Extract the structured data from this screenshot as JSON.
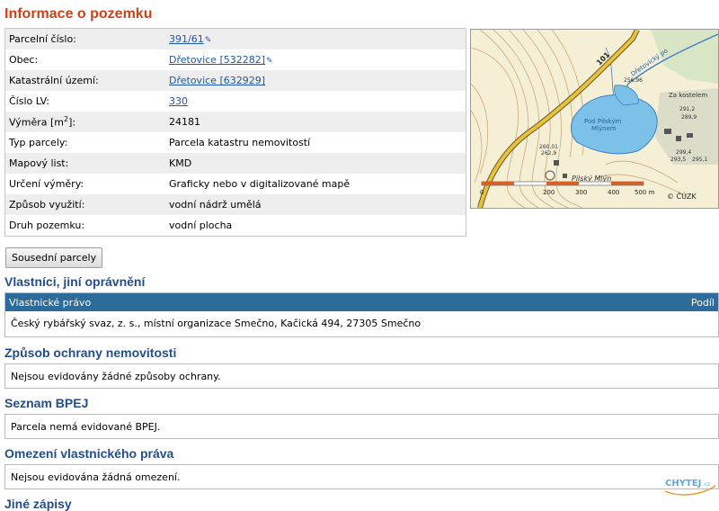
{
  "page_title": "Informace o pozemku",
  "parcel": {
    "rows": [
      {
        "key": "Parcelní číslo:",
        "value": "391/61",
        "link": true,
        "edit": true
      },
      {
        "key": "Obec:",
        "value": "Dřetovice [532282]",
        "link": true,
        "edit": true
      },
      {
        "key": "Katastrální území:",
        "value": "Dřetovice [632929]",
        "link": true,
        "edit": false
      },
      {
        "key": "Číslo LV:",
        "value": "330",
        "link": true,
        "edit": false
      },
      {
        "key_prefix": "Výměra [m",
        "key_sup": "2",
        "key_suffix": "]:",
        "value": "24181",
        "link": false
      },
      {
        "key": "Typ parcely:",
        "value": "Parcela katastru nemovitostí",
        "link": false
      },
      {
        "key": "Mapový list:",
        "value": "KMD",
        "link": false
      },
      {
        "key": "Určení výměry:",
        "value": "Graficky nebo v digitalizované mapě",
        "link": false
      },
      {
        "key": "Způsob využití:",
        "value": "vodní nádrž umělá",
        "link": false
      },
      {
        "key": "Druh pozemku:",
        "value": "vodní plocha",
        "link": false
      }
    ]
  },
  "map": {
    "labels": {
      "pond": "Pod Pilským",
      "pond2": "Mlýnem",
      "mill": "Pilský Mlýn",
      "stream": "Dřetovický po",
      "kostelem": "Za kostelem",
      "road": "101",
      "copyright": "© ČÚZK"
    },
    "heights": [
      "256,96",
      "260,01",
      "291,2",
      "289,9",
      "293,5",
      "295,1",
      "262,9",
      "299,4"
    ],
    "scale": [
      "0",
      "200",
      "300",
      "400",
      "500 m"
    ],
    "colors": {
      "water": "#7cc1e8",
      "bg": "#f5efd6",
      "contour": "#c9a97a",
      "road": "#e8c23a",
      "scalebar": "#d4622a"
    }
  },
  "buttons": {
    "neighbors": "Sousední parcely"
  },
  "owners": {
    "title": "Vlastníci, jiní oprávnění",
    "col_left": "Vlastnické právo",
    "col_right": "Podíl",
    "row": "Český rybářský svaz, z. s., místní organizace Smečno, Kačická 494, 27305 Smečno"
  },
  "protection": {
    "title": "Způsob ochrany nemovitosti",
    "text": "Nejsou evidovány žádné způsoby ochrany."
  },
  "bpej": {
    "title": "Seznam BPEJ",
    "text": "Parcela nemá evidované BPEJ."
  },
  "restrictions": {
    "title": "Omezení vlastnického práva",
    "text": "Nejsou evidována žádná omezení."
  },
  "other": {
    "title": "Jiné zápisy"
  },
  "logo": {
    "text": "CHYTEJ",
    "suffix": ".cz"
  }
}
